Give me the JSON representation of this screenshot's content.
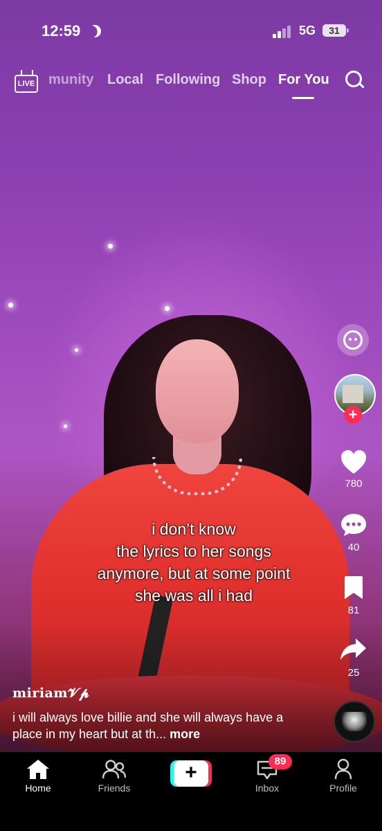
{
  "status_bar": {
    "time": "12:59",
    "network": "5G",
    "battery": "31",
    "dnd_icon": "moon-icon",
    "signal_icon": "cellular-signal-icon"
  },
  "top_nav": {
    "live_label": "LIVE",
    "tabs": [
      {
        "label": "munity"
      },
      {
        "label": "Local"
      },
      {
        "label": "Following"
      },
      {
        "label": "Shop"
      },
      {
        "label": "For You"
      }
    ],
    "active_tab": "For You",
    "search_icon": "search-icon"
  },
  "video": {
    "caption_lines": [
      "i don’t know",
      "the lyrics to her songs",
      "anymore, but at some point",
      "she was all i had"
    ]
  },
  "actions": {
    "likes": "780",
    "comments": "40",
    "saves": "81",
    "shares": "25",
    "follow_symbol": "+"
  },
  "post": {
    "username": "miriam𝓥𝓹",
    "description": "i will always love billie and she will always have a place in my heart but at th...",
    "more_label": "more"
  },
  "bottom_nav": {
    "items": [
      {
        "label": "Home"
      },
      {
        "label": "Friends"
      },
      {
        "label": ""
      },
      {
        "label": "Inbox"
      },
      {
        "label": "Profile"
      }
    ],
    "create_symbol": "+",
    "inbox_badge": "89"
  },
  "colors": {
    "accent_red": "#fe2c55",
    "accent_cyan": "#25f4ee"
  }
}
